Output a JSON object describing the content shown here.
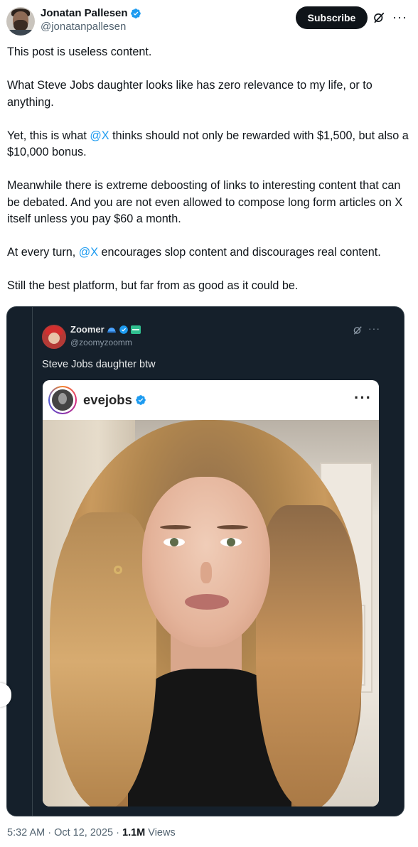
{
  "post": {
    "author_name": "Jonatan Pallesen",
    "author_handle": "@jonatanpallesen",
    "subscribe_label": "Subscribe",
    "p1": "This post is useless content.",
    "p2": "What Steve Jobs daughter looks like has zero relevance to my life, or to anything.",
    "p3_before": "Yet, this is what ",
    "p3_mention": "@X",
    "p3_after": " thinks should not only be rewarded with $1,500, but also a $10,000 bonus.",
    "p4": "Meanwhile there is extreme deboosting of links to interesting content that can be debated. And you are not even allowed to compose long form articles on X itself unless you pay $60 a month.",
    "p5_before": "At every turn, ",
    "p5_mention": "@X",
    "p5_after": " encourages slop content and discourages real content.",
    "p6": "Still the best platform, but far from as good as it could be.",
    "timestamp": "5:32 AM · Oct 12, 2025 · ",
    "views_count": "1.1M",
    "views_label": " Views"
  },
  "quoted": {
    "author_name": "Zoomer",
    "author_handle": "@zoomyzoomm",
    "text": "Steve Jobs daughter btw",
    "ig_username": "evejobs"
  },
  "icons": {
    "verified": "verified-badge-icon",
    "grok": "grok-icon",
    "more": "more-icon"
  },
  "colors": {
    "link": "#1d9bf0",
    "verified": "#1d9bf0",
    "quote_bg": "#15202b"
  }
}
